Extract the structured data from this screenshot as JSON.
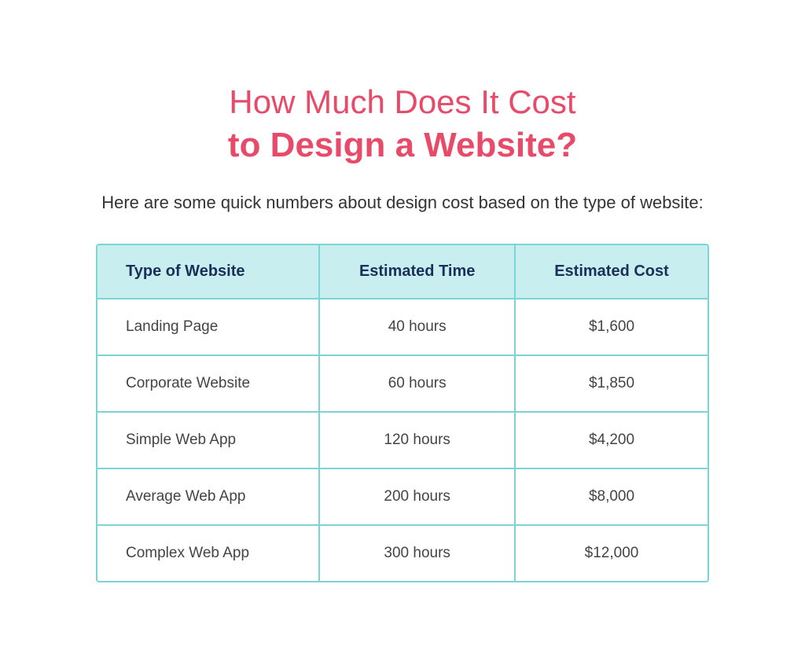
{
  "header": {
    "title_line1": "How Much Does It Cost",
    "title_line2": "to Design a Website?",
    "subtitle": "Here are some quick numbers about design cost based on the type of website:"
  },
  "table": {
    "columns": [
      {
        "id": "type",
        "label": "Type of Website"
      },
      {
        "id": "time",
        "label": "Estimated Time"
      },
      {
        "id": "cost",
        "label": "Estimated Cost"
      }
    ],
    "rows": [
      {
        "type": "Landing Page",
        "time": "40 hours",
        "cost": "$1,600"
      },
      {
        "type": "Corporate Website",
        "time": "60 hours",
        "cost": "$1,850"
      },
      {
        "type": "Simple Web App",
        "time": "120 hours",
        "cost": "$4,200"
      },
      {
        "type": "Average Web App",
        "time": "200 hours",
        "cost": "$8,000"
      },
      {
        "type": "Complex Web App",
        "time": "300 hours",
        "cost": "$12,000"
      }
    ]
  }
}
